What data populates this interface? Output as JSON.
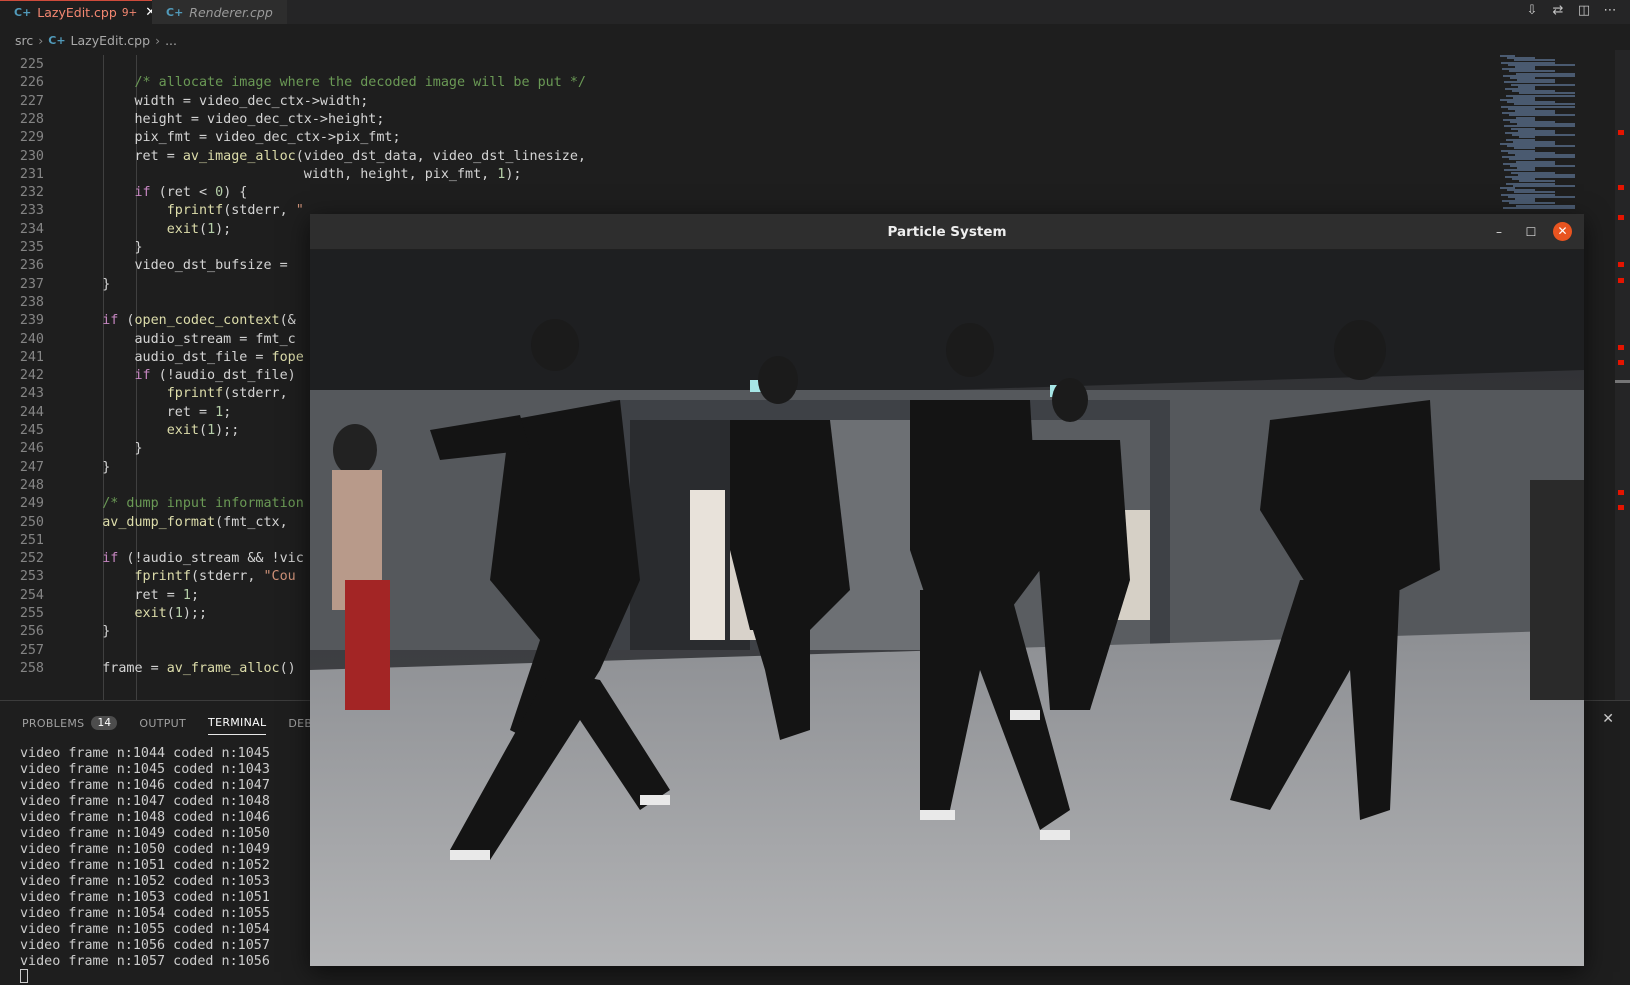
{
  "tabs": [
    {
      "label": "LazyEdit.cpp",
      "problems": "9+",
      "active": true
    },
    {
      "label": "Renderer.cpp",
      "active": false
    }
  ],
  "breadcrumb": {
    "folder": "src",
    "file": "LazyEdit.cpp",
    "rest": "..."
  },
  "editor": {
    "lines": [
      {
        "n": "225",
        "html": ""
      },
      {
        "n": "226",
        "html": "        <span class='cm'>/* allocate image where the decoded image will be put */</span>"
      },
      {
        "n": "227",
        "html": "        width = video_dec_ctx-&gt;width;"
      },
      {
        "n": "228",
        "html": "        height = video_dec_ctx-&gt;height;"
      },
      {
        "n": "229",
        "html": "        pix_fmt = video_dec_ctx-&gt;pix_fmt;"
      },
      {
        "n": "230",
        "html": "        ret = <span class='fn'>av_image_alloc</span>(video_dst_data, video_dst_linesize,"
      },
      {
        "n": "231",
        "html": "                             width, height, pix_fmt, <span class='nm'>1</span>);"
      },
      {
        "n": "232",
        "html": "        <span class='kw'>if</span> (ret &lt; <span class='nm'>0</span>) {"
      },
      {
        "n": "233",
        "html": "            <span class='fn'>fprintf</span>(stderr, <span class='st'>\"</span>"
      },
      {
        "n": "234",
        "html": "            <span class='fn'>exit</span>(<span class='nm'>1</span>);"
      },
      {
        "n": "235",
        "html": "        }"
      },
      {
        "n": "236",
        "html": "        video_dst_bufsize = "
      },
      {
        "n": "237",
        "html": "    }"
      },
      {
        "n": "238",
        "html": ""
      },
      {
        "n": "239",
        "html": "    <span class='kw'>if</span> (<span class='fn'>open_codec_context</span>(&amp;"
      },
      {
        "n": "240",
        "html": "        audio_stream = fmt_c"
      },
      {
        "n": "241",
        "html": "        audio_dst_file = <span class='fn'>fope</span>"
      },
      {
        "n": "242",
        "html": "        <span class='kw'>if</span> (!audio_dst_file)"
      },
      {
        "n": "243",
        "html": "            <span class='fn'>fprintf</span>(stderr, "
      },
      {
        "n": "244",
        "html": "            ret = <span class='nm'>1</span>;"
      },
      {
        "n": "245",
        "html": "            <span class='fn'>exit</span>(<span class='nm'>1</span>);;"
      },
      {
        "n": "246",
        "html": "        }"
      },
      {
        "n": "247",
        "html": "    }"
      },
      {
        "n": "248",
        "html": ""
      },
      {
        "n": "249",
        "html": "    <span class='cm'>/* dump input information</span>"
      },
      {
        "n": "250",
        "html": "    <span class='fn'>av_dump_format</span>(fmt_ctx, "
      },
      {
        "n": "251",
        "html": ""
      },
      {
        "n": "252",
        "html": "    <span class='kw'>if</span> (!audio_stream &amp;&amp; !vic"
      },
      {
        "n": "253",
        "html": "        <span class='fn'>fprintf</span>(stderr, <span class='st'>\"Cou</span>"
      },
      {
        "n": "254",
        "html": "        ret = <span class='nm'>1</span>;"
      },
      {
        "n": "255",
        "html": "        <span class='fn'>exit</span>(<span class='nm'>1</span>);;"
      },
      {
        "n": "256",
        "html": "    }"
      },
      {
        "n": "257",
        "html": ""
      },
      {
        "n": "258",
        "html": "    frame = <span class='fn'>av_frame_alloc</span>()"
      }
    ]
  },
  "panel": {
    "tabs": [
      {
        "label": "PROBLEMS",
        "badge": "14"
      },
      {
        "label": "OUTPUT"
      },
      {
        "label": "TERMINAL",
        "active": true
      },
      {
        "label": "DEBUG"
      }
    ],
    "terminal_lines": [
      "video frame n:1044 coded n:1045",
      "video frame n:1045 coded n:1043",
      "video frame n:1046 coded n:1047",
      "video frame n:1047 coded n:1048",
      "video frame n:1048 coded n:1046",
      "video frame n:1049 coded n:1050",
      "video frame n:1050 coded n:1049",
      "video frame n:1051 coded n:1052",
      "video frame n:1052 coded n:1053",
      "video frame n:1053 coded n:1051",
      "video frame n:1054 coded n:1055",
      "video frame n:1055 coded n:1054",
      "video frame n:1056 coded n:1057",
      "video frame n:1057 coded n:1056"
    ]
  },
  "window": {
    "title": "Particle System"
  },
  "icons": {
    "tab_close": "close-icon",
    "window_minimize": "minimize-icon",
    "window_maximize": "maximize-icon",
    "window_close": "close-icon",
    "panel_close": "close-icon"
  }
}
